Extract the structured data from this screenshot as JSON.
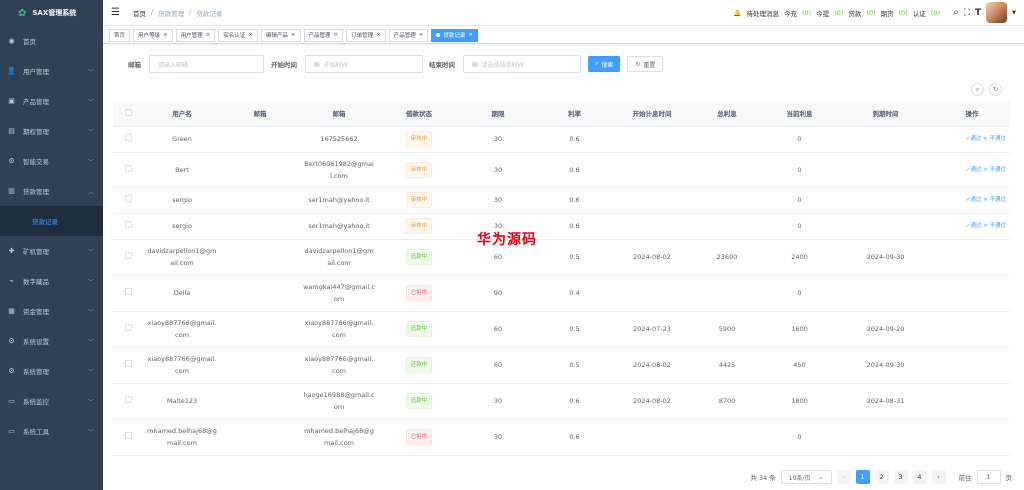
{
  "app": {
    "title": "SAX管理系统"
  },
  "sidebar": {
    "items": [
      {
        "label": "首页",
        "icon": "dashboard-icon"
      },
      {
        "label": "用户管理",
        "icon": "user-icon"
      },
      {
        "label": "产品管理",
        "icon": "product-icon"
      },
      {
        "label": "期权管理",
        "icon": "option-icon"
      },
      {
        "label": "智能交易",
        "icon": "trade-icon"
      },
      {
        "label": "贷款管理",
        "icon": "loan-icon"
      },
      {
        "label": "贷款记录",
        "icon": ""
      },
      {
        "label": "矿机管理",
        "icon": "miner-icon"
      },
      {
        "label": "数字藏品",
        "icon": "collection-icon"
      },
      {
        "label": "资金管理",
        "icon": "fund-icon"
      },
      {
        "label": "系统设置",
        "icon": "settings-icon"
      },
      {
        "label": "系统管理",
        "icon": "system-icon"
      },
      {
        "label": "系统监控",
        "icon": "monitor-icon"
      },
      {
        "label": "系统工具",
        "icon": "tool-icon"
      }
    ]
  },
  "navbar": {
    "breadcrumb": [
      "首页",
      "贷款管理",
      "贷款记录"
    ],
    "notice": "待处理消息",
    "counters": [
      {
        "label": "今充",
        "value": "(0)"
      },
      {
        "label": "今提",
        "value": "(0)"
      },
      {
        "label": "贷款",
        "value": "(0)"
      },
      {
        "label": "期货",
        "value": "(0)"
      },
      {
        "label": "认证",
        "value": "(0)"
      }
    ]
  },
  "tags": [
    "首页",
    "用户等级",
    "用户管理",
    "实名认证",
    "编辑产品",
    "产品管理",
    "订单管理",
    "产品管理",
    "贷款记录"
  ],
  "filter": {
    "email_label": "邮箱",
    "email_placeholder": "请输入邮箱",
    "start_label": "开始时间",
    "start_placeholder": "开始时间",
    "end_label": "结束时间",
    "end_placeholder": "请选择结束时间",
    "search": "搜索",
    "reset": "重置"
  },
  "table": {
    "headers": [
      "用户名",
      "邮箱",
      "邮箱",
      "借款状态",
      "期限",
      "利率",
      "开始计息时间",
      "总利息",
      "当前利息",
      "到期时间",
      "操作"
    ],
    "rows": [
      {
        "username": "Green",
        "email1": "",
        "email2": "167525662",
        "status": "审核中",
        "status_type": "pending",
        "term": "30",
        "rate": "0.6",
        "start": "",
        "total": "",
        "current": "0",
        "due": "",
        "ops": "✓通过 × 不通过"
      },
      {
        "username": "Bert",
        "email1": "",
        "email2": "Bert06061982@gmail.com",
        "status": "审核中",
        "status_type": "pending",
        "term": "30",
        "rate": "0.6",
        "start": "",
        "total": "",
        "current": "0",
        "due": "",
        "ops": "✓通过 × 不通过"
      },
      {
        "username": "sergio",
        "email1": "",
        "email2": "ser1mah@yahoo.it",
        "status": "审核中",
        "status_type": "pending",
        "term": "30",
        "rate": "0.6",
        "start": "",
        "total": "",
        "current": "0",
        "due": "",
        "ops": "✓通过 × 不通过"
      },
      {
        "username": "sergio",
        "email1": "",
        "email2": "ser1mah@yahoo.it",
        "status": "审核中",
        "status_type": "pending",
        "term": "30",
        "rate": "0.6",
        "start": "",
        "total": "",
        "current": "0",
        "due": "",
        "ops": "✓通过 × 不通过"
      },
      {
        "username": "davidzarpellon1@gmail.com",
        "email1": "",
        "email2": "davidzarpellon1@gmail.com",
        "status": "还款中",
        "status_type": "repay",
        "term": "60",
        "rate": "0.5",
        "start": "2024-08-02",
        "total": "23600",
        "current": "2400",
        "due": "2024-09-30",
        "ops": ""
      },
      {
        "username": "Della",
        "email1": "",
        "email2": "wamgkai447@gmail.com",
        "status": "已拒绝",
        "status_type": "rejected",
        "term": "90",
        "rate": "0.4",
        "start": "",
        "total": "",
        "current": "0",
        "due": "",
        "ops": ""
      },
      {
        "username": "xiaoy887766@gmail.com",
        "email1": "",
        "email2": "xiaoy887766@gmail.com",
        "status": "还款中",
        "status_type": "repay",
        "term": "60",
        "rate": "0.5",
        "start": "2024-07-23",
        "total": "5900",
        "current": "1600",
        "due": "2024-09-20",
        "ops": ""
      },
      {
        "username": "xiaoy887766@gmail.com",
        "email1": "",
        "email2": "xiaoy887766@gmail.com",
        "status": "还款中",
        "status_type": "repay",
        "term": "60",
        "rate": "0.5",
        "start": "2024-08-02",
        "total": "4425",
        "current": "450",
        "due": "2024-09-30",
        "ops": ""
      },
      {
        "username": "Malte123",
        "email1": "",
        "email2": "haoge16988@gmail.com",
        "status": "还款中",
        "status_type": "repay",
        "term": "30",
        "rate": "0.6",
        "start": "2024-08-02",
        "total": "8700",
        "current": "1800",
        "due": "2024-08-31",
        "ops": ""
      },
      {
        "username": "mhamed.belhaj68@gmail.com",
        "email1": "",
        "email2": "mhamed.belhaj68@gmail.com",
        "status": "已拒绝",
        "status_type": "rejected",
        "term": "30",
        "rate": "0.6",
        "start": "",
        "total": "",
        "current": "0",
        "due": "",
        "ops": ""
      }
    ]
  },
  "watermark": "华为源码",
  "pagination": {
    "total": "共 34 条",
    "page_size": "10条/页",
    "pages": [
      "1",
      "2",
      "3",
      "4"
    ],
    "current": "1",
    "goto_label": "前往",
    "goto_value": "1",
    "page_unit": "页"
  }
}
